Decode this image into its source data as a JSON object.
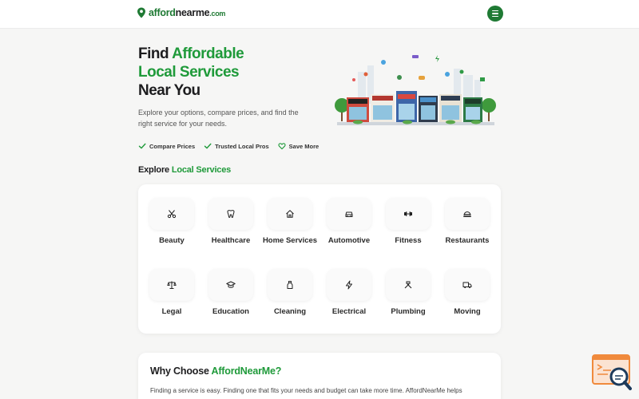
{
  "header": {
    "logo": {
      "part1": "afford",
      "part2": "nearme",
      "part3": ".com"
    },
    "menu_icon": "hamburger-menu-icon"
  },
  "hero": {
    "title_line1_a": "Find ",
    "title_line1_b": "Affordable",
    "title_line2": "Local Services",
    "title_line3": "Near You",
    "subtitle": "Explore your options, compare prices, and find the right service for your needs.",
    "checks": [
      {
        "label": "Compare Prices",
        "icon": "check-icon"
      },
      {
        "label": "Trusted Local Pros",
        "icon": "check-icon"
      },
      {
        "label": "Save More",
        "icon": "heart-icon"
      }
    ]
  },
  "explore": {
    "title_a": "Explore ",
    "title_b": "Local Services",
    "services": [
      {
        "label": "Beauty",
        "icon": "scissors-icon"
      },
      {
        "label": "Healthcare",
        "icon": "tooth-icon"
      },
      {
        "label": "Home Services",
        "icon": "house-icon"
      },
      {
        "label": "Automotive",
        "icon": "car-icon"
      },
      {
        "label": "Fitness",
        "icon": "dumbbell-icon"
      },
      {
        "label": "Restaurants",
        "icon": "food-tray-icon"
      },
      {
        "label": "Legal",
        "icon": "scales-icon"
      },
      {
        "label": "Education",
        "icon": "graduation-cap-icon"
      },
      {
        "label": "Cleaning",
        "icon": "spray-bottle-icon"
      },
      {
        "label": "Electrical",
        "icon": "lightning-icon"
      },
      {
        "label": "Plumbing",
        "icon": "wrench-icon"
      },
      {
        "label": "Moving",
        "icon": "truck-icon"
      }
    ]
  },
  "why": {
    "title_a": "Why Choose ",
    "title_b": "AffordNearMe?",
    "text": "Finding a service is easy. Finding one that fits your needs and budget can take more time. AffordNearMe helps"
  },
  "colors": {
    "brand_green": "#1f7a34",
    "accent_green": "#1f9a3a",
    "help_orange": "#f08a3c"
  },
  "widget": {
    "icon": "help-search-icon"
  }
}
